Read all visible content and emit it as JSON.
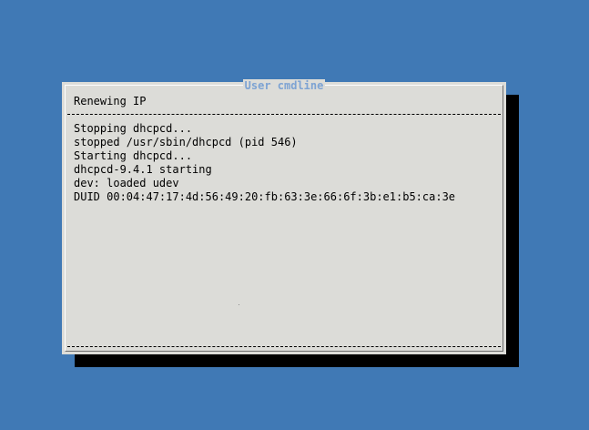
{
  "dialog": {
    "title": "User cmdline",
    "subtitle": "Renewing IP",
    "output_lines": [
      "Stopping dhcpcd...",
      "stopped /usr/sbin/dhcpcd (pid 546)",
      "Starting dhcpcd...",
      "dhcpcd-9.4.1 starting",
      "dev: loaded udev",
      "DUID 00:04:47:17:4d:56:49:20:fb:63:3e:66:6f:3b:e1:b5:ca:3e"
    ]
  },
  "colors": {
    "desktop_background": "#4079b5",
    "dialog_background": "#dcdcd8",
    "title_text": "#7da3d3",
    "shadow": "#000000"
  }
}
